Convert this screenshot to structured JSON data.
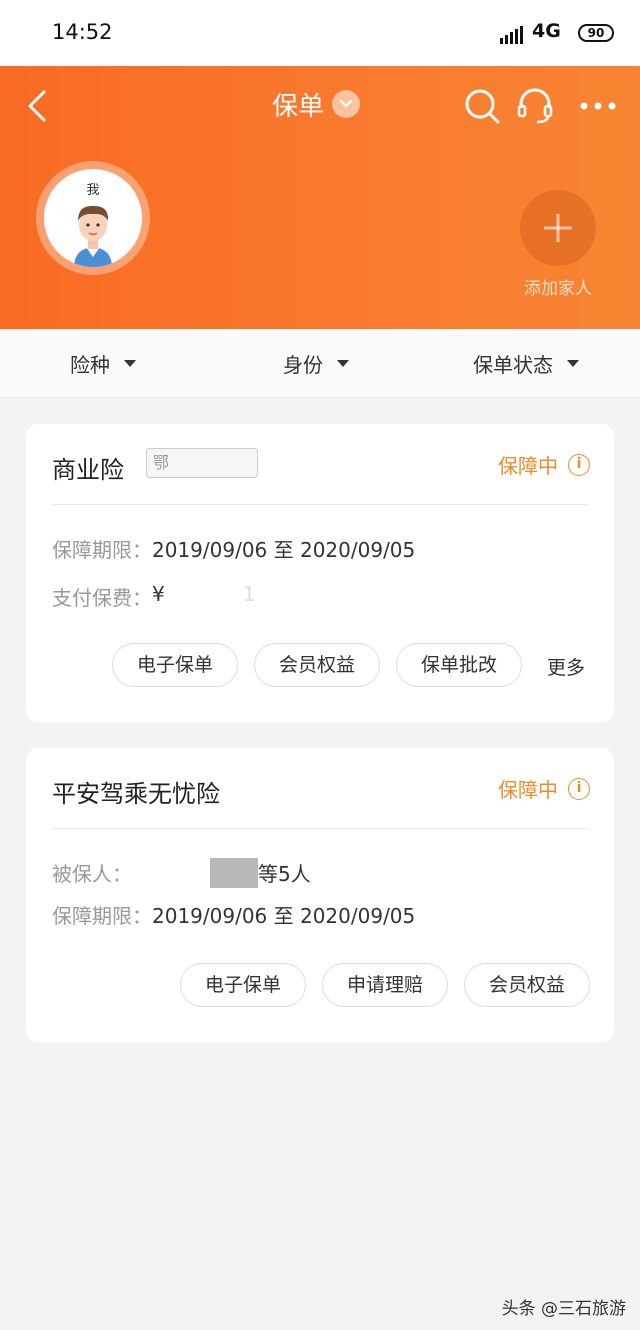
{
  "status_bar": {
    "time": "14:52",
    "network": "4G",
    "battery": "90"
  },
  "header": {
    "title": "保单",
    "avatar_label": "我",
    "add_family_label": "添加家人"
  },
  "filters": [
    {
      "label": "险种"
    },
    {
      "label": "身份"
    },
    {
      "label": "保单状态"
    }
  ],
  "policies": [
    {
      "title": "商业险",
      "plate_tag": "鄂",
      "status": "保障中",
      "rows": [
        {
          "label": "保障期限：",
          "value": "2019/09/06 至 2020/09/05"
        },
        {
          "label": "支付保费：",
          "value": "¥",
          "value_tail": "1"
        }
      ],
      "actions": [
        "电子保单",
        "会员权益",
        "保单批改"
      ],
      "more": "更多"
    },
    {
      "title": "平安驾乘无忧险",
      "status": "保障中",
      "rows": [
        {
          "label": "被保人：",
          "value": "等5人"
        },
        {
          "label": "保障期限：",
          "value": "2019/09/06 至 2020/09/05"
        }
      ],
      "actions": [
        "电子保单",
        "申请理赔",
        "会员权益"
      ]
    }
  ],
  "watermark": "头条 @三石旅游",
  "colors": {
    "accent": "#f97a2e",
    "status": "#f08a2a",
    "background": "#f3f3f3"
  }
}
